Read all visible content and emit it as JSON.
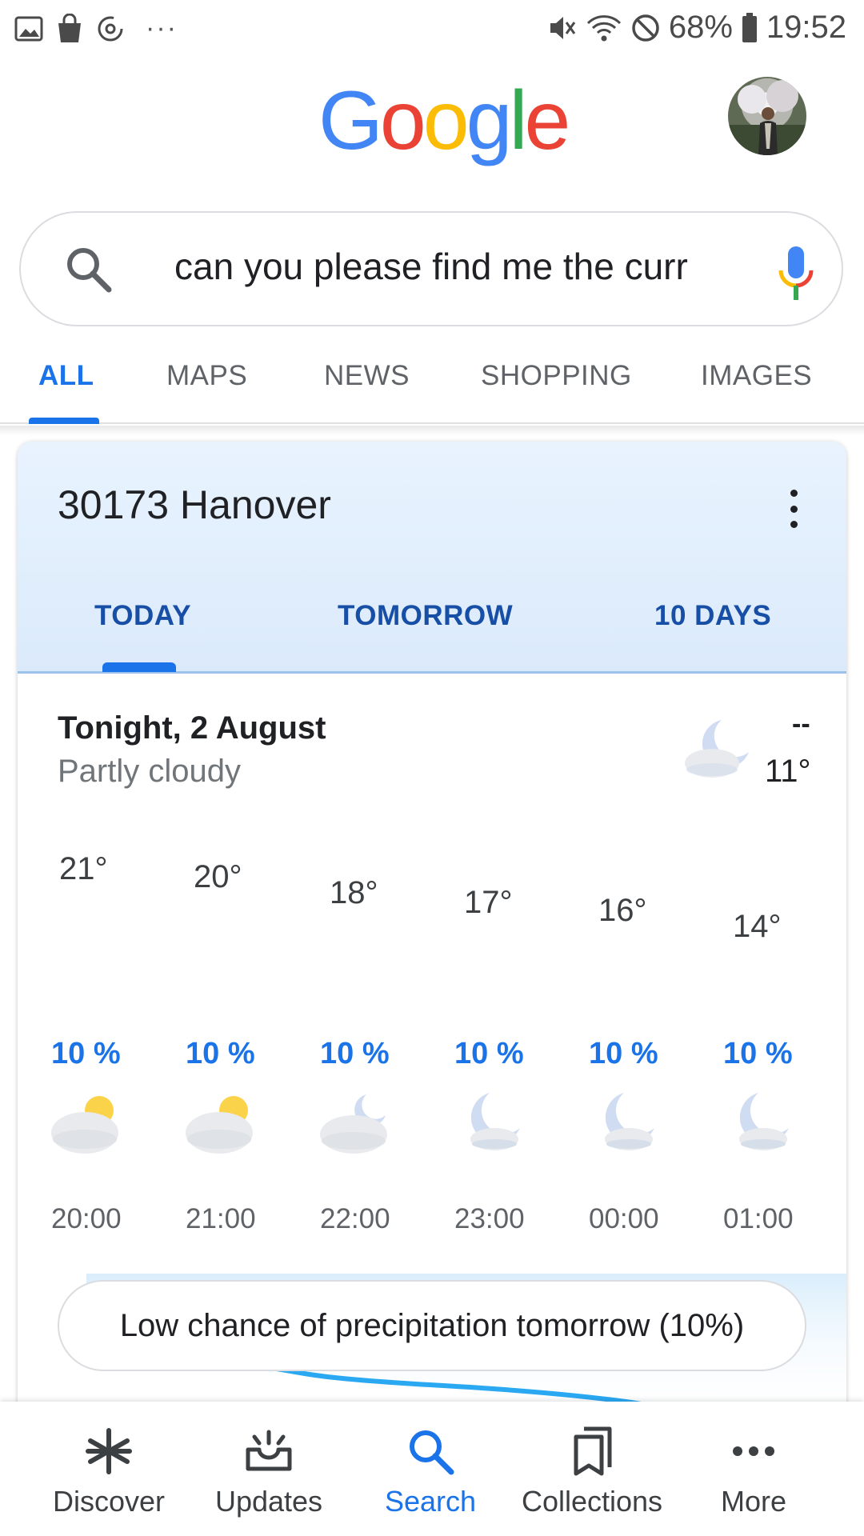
{
  "status_bar": {
    "battery": "68%",
    "time": "19:52",
    "left_icons": [
      "image-icon",
      "shopping-bag-icon",
      "data-saver-icon"
    ],
    "overflow": "···",
    "right_icons": [
      "mute-icon",
      "wifi-icon",
      "do-not-disturb-icon",
      "battery-icon"
    ]
  },
  "header": {
    "logo_letters": [
      "G",
      "o",
      "o",
      "g",
      "l",
      "e"
    ],
    "logo_colors": [
      "#4285F4",
      "#EA4335",
      "#FBBC05",
      "#4285F4",
      "#34A853",
      "#EA4335"
    ]
  },
  "search": {
    "query": "can you please find me the curr",
    "icons": [
      "search-icon",
      "mic-icon"
    ]
  },
  "tabs": {
    "items": [
      "ALL",
      "MAPS",
      "NEWS",
      "SHOPPING",
      "IMAGES"
    ],
    "active": "ALL",
    "accent": "#1a73e8"
  },
  "weather": {
    "location": "30173 Hanover",
    "tabs": [
      "TODAY",
      "TOMORROW",
      "10 DAYS"
    ],
    "active_tab": "TODAY",
    "tonight_title": "Tonight, 2 August",
    "condition": "Partly cloudy",
    "high": "--",
    "low": "11°",
    "hours": [
      {
        "temp": "21°",
        "precip": "10 %",
        "icon": "partly-cloudy-day-icon",
        "time": "20:00"
      },
      {
        "temp": "20°",
        "precip": "10 %",
        "icon": "partly-cloudy-day-icon",
        "time": "21:00"
      },
      {
        "temp": "18°",
        "precip": "10 %",
        "icon": "partly-cloudy-night-icon",
        "time": "22:00"
      },
      {
        "temp": "17°",
        "precip": "10 %",
        "icon": "mostly-clear-night-icon",
        "time": "23:00"
      },
      {
        "temp": "16°",
        "precip": "10 %",
        "icon": "mostly-clear-night-icon",
        "time": "00:00"
      },
      {
        "temp": "14°",
        "precip": "10 %",
        "icon": "mostly-clear-night-icon",
        "time": "01:00"
      }
    ],
    "precip_summary": "Low chance of precipitation tomorrow (10%)",
    "line_color": "#2aa8f2"
  },
  "bottom_nav": {
    "items": [
      {
        "label": "Discover",
        "icon": "asterisk-icon"
      },
      {
        "label": "Updates",
        "icon": "updates-tray-icon"
      },
      {
        "label": "Search",
        "icon": "search-icon"
      },
      {
        "label": "Collections",
        "icon": "bookmarks-icon"
      },
      {
        "label": "More",
        "icon": "more-dots-icon"
      }
    ],
    "active": "Search"
  }
}
